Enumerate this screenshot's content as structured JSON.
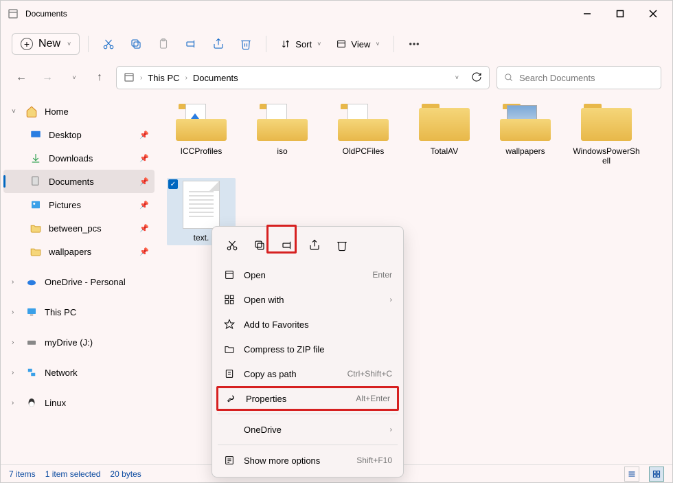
{
  "window": {
    "title": "Documents"
  },
  "toolbar": {
    "new": "New",
    "sort": "Sort",
    "view": "View"
  },
  "breadcrumb": {
    "seg1": "This PC",
    "seg2": "Documents"
  },
  "search": {
    "placeholder": "Search Documents"
  },
  "sidebar": {
    "home": "Home",
    "desktop": "Desktop",
    "downloads": "Downloads",
    "documents": "Documents",
    "pictures": "Pictures",
    "between_pcs": "between_pcs",
    "wallpapers": "wallpapers",
    "onedrive": "OneDrive - Personal",
    "thispc": "This PC",
    "mydrive": "myDrive (J:)",
    "network": "Network",
    "linux": "Linux"
  },
  "folders": [
    {
      "name": "ICCProfiles"
    },
    {
      "name": "iso"
    },
    {
      "name": "OldPCFiles"
    },
    {
      "name": "TotalAV"
    },
    {
      "name": "wallpapers"
    },
    {
      "name": "WindowsPowerShell"
    }
  ],
  "file": {
    "name": "text."
  },
  "context_menu": {
    "open": "Open",
    "open_sc": "Enter",
    "openwith": "Open with",
    "favorites": "Add to Favorites",
    "compress": "Compress to ZIP file",
    "copypath": "Copy as path",
    "copypath_sc": "Ctrl+Shift+C",
    "properties": "Properties",
    "properties_sc": "Alt+Enter",
    "onedrive": "OneDrive",
    "more": "Show more options",
    "more_sc": "Shift+F10"
  },
  "status": {
    "items": "7 items",
    "selected": "1 item selected",
    "size": "20 bytes"
  }
}
